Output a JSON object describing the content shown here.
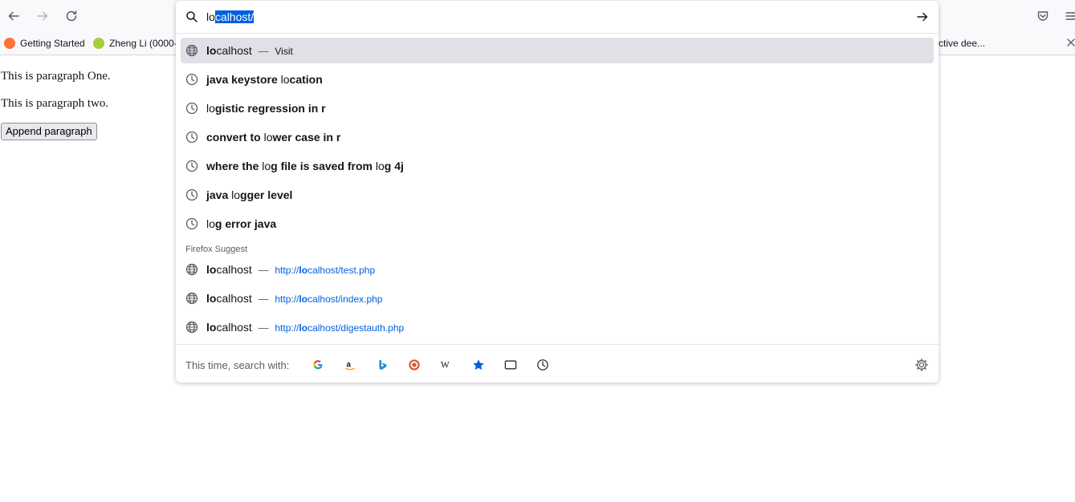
{
  "toolbar": {
    "back_icon": "arrow-left-icon",
    "forward_icon": "arrow-right-icon",
    "reload_icon": "reload-icon"
  },
  "bookmarks": [
    {
      "label": "Getting Started",
      "icon": "firefox-icon",
      "color": "#ff7139"
    },
    {
      "label": "Zheng Li (0000-",
      "icon": "orcid-icon",
      "color": "#a6ce39"
    },
    {
      "label": "ctive dee...",
      "icon": "",
      "color": ""
    }
  ],
  "page": {
    "para1": "This is paragraph One.",
    "para2": "This is paragraph two.",
    "append_button": "Append paragraph"
  },
  "urlbar": {
    "typed": "lo",
    "selected": "calhost/"
  },
  "results": [
    {
      "type": "visit",
      "bold": "lo",
      "rest": "calhost",
      "sep": "—",
      "action": "Visit"
    },
    {
      "type": "history",
      "parts": [
        [
          "b",
          "java keystore "
        ],
        [
          "n",
          "lo"
        ],
        [
          "b",
          "cation"
        ]
      ]
    },
    {
      "type": "history",
      "parts": [
        [
          "n",
          "lo"
        ],
        [
          "b",
          "gistic regression in r"
        ]
      ]
    },
    {
      "type": "history",
      "parts": [
        [
          "b",
          "convert to "
        ],
        [
          "n",
          "lo"
        ],
        [
          "b",
          "wer case in r"
        ]
      ]
    },
    {
      "type": "history",
      "parts": [
        [
          "b",
          "where the "
        ],
        [
          "n",
          "lo"
        ],
        [
          "b",
          "g file is saved from "
        ],
        [
          "n",
          "lo"
        ],
        [
          "b",
          "g 4j"
        ]
      ]
    },
    {
      "type": "history",
      "parts": [
        [
          "b",
          "java "
        ],
        [
          "n",
          "lo"
        ],
        [
          "b",
          "gger level"
        ]
      ]
    },
    {
      "type": "history",
      "parts": [
        [
          "n",
          "lo"
        ],
        [
          "b",
          "g error java"
        ]
      ]
    }
  ],
  "suggest_label": "Firefox Suggest",
  "suggest": [
    {
      "bold": "lo",
      "rest": "calhost",
      "sep": "—",
      "url_pre": "http://",
      "url_bold": "lo",
      "url_post": "calhost/test.php"
    },
    {
      "bold": "lo",
      "rest": "calhost",
      "sep": "—",
      "url_pre": "http://",
      "url_bold": "lo",
      "url_post": "calhost/index.php"
    },
    {
      "bold": "lo",
      "rest": "calhost",
      "sep": "—",
      "url_pre": "http://",
      "url_bold": "lo",
      "url_post": "calhost/digestauth.php"
    }
  ],
  "footer": {
    "label": "This time, search with:",
    "engines": [
      "google-icon",
      "amazon-icon",
      "bing-icon",
      "duckduckgo-icon",
      "wikipedia-icon",
      "bookmarks-star-icon",
      "tabs-icon",
      "history-icon"
    ],
    "settings_icon": "gear-icon"
  }
}
